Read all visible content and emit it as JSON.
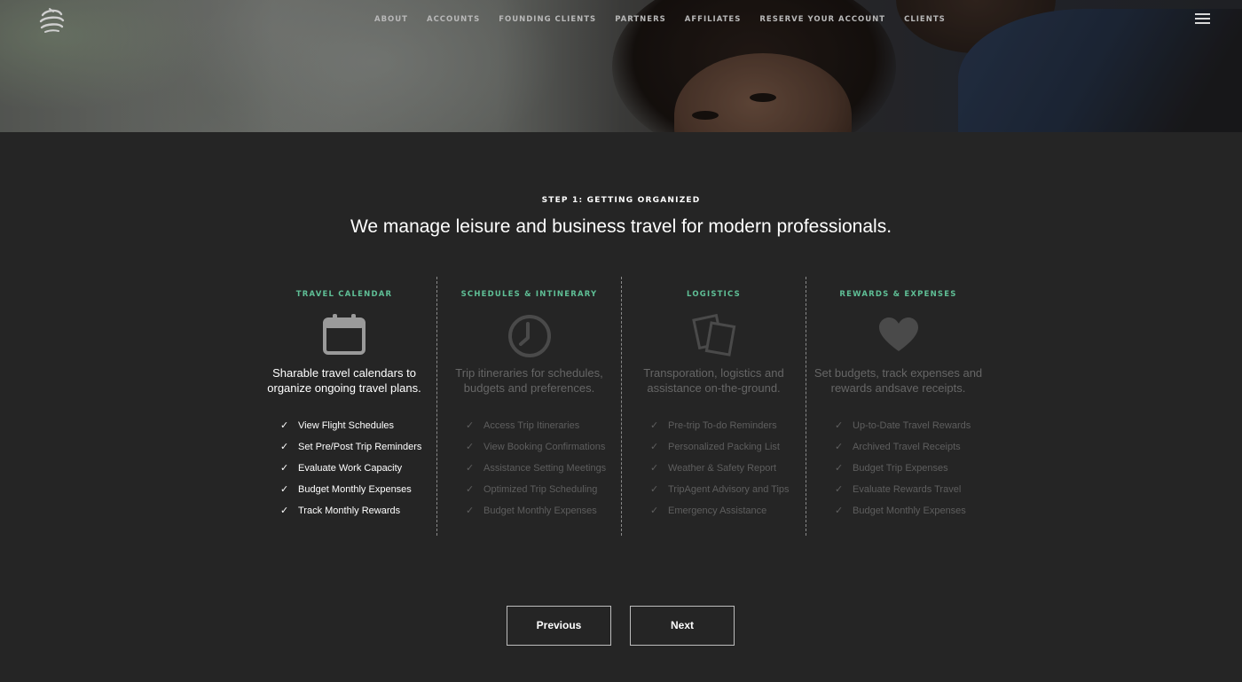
{
  "nav": {
    "items": [
      {
        "label": "ABOUT"
      },
      {
        "label": "ACCOUNTS"
      },
      {
        "label": "FOUNDING CLIENTS"
      },
      {
        "label": "PARTNERS"
      },
      {
        "label": "AFFILIATES"
      },
      {
        "label": "RESERVE YOUR ACCOUNT"
      },
      {
        "label": "CLIENTS"
      }
    ],
    "logo_icon": "globe-logo-icon",
    "menu_icon": "hamburger-menu-icon"
  },
  "step": {
    "label": "STEP 1: GETTING ORGANIZED",
    "headline": "We manage leisure and business travel for modern professionals."
  },
  "columns": [
    {
      "title": "TRAVEL CALENDAR",
      "icon": "calendar-icon",
      "description": "Sharable travel calendars to organize ongoing travel plans.",
      "active": true,
      "items": [
        "View Flight Schedules",
        "Set Pre/Post Trip Reminders",
        "Evaluate Work Capacity",
        "Budget Monthly Expenses",
        "Track Monthly Rewards"
      ]
    },
    {
      "title": "SCHEDULES & INTINERARY",
      "icon": "clock-icon",
      "description": "Trip itineraries for schedules, budgets and preferences.",
      "active": false,
      "items": [
        "Access Trip Itineraries",
        "View Booking Confirmations",
        "Assistance Setting Meetings",
        "Optimized Trip Scheduling",
        "Budget Monthly Expenses"
      ]
    },
    {
      "title": "LOGISTICS",
      "icon": "documents-icon",
      "description": "Transporation, logistics and assistance on-the-ground.",
      "active": false,
      "items": [
        "Pre-trip To-do Reminders",
        "Personalized Packing List",
        "Weather & Safety Report",
        "TripAgent Advisory and Tips",
        "Emergency Assistance"
      ]
    },
    {
      "title": "REWARDS & EXPENSES",
      "icon": "heart-icon",
      "description": "Set budgets, track expenses and rewards andsave receipts.",
      "active": false,
      "items": [
        "Up-to-Date Travel Rewards",
        "Archived Travel Receipts",
        "Budget Trip Expenses",
        "Evaluate Rewards Travel",
        "Budget Monthly Expenses"
      ]
    }
  ],
  "check_glyph": "✓",
  "buttons": {
    "previous": "Previous",
    "next": "Next"
  },
  "colors": {
    "background": "#252525",
    "accent_green": "#5fbf96",
    "muted_text": "#5e5e5e",
    "active_text": "#ffffff"
  }
}
